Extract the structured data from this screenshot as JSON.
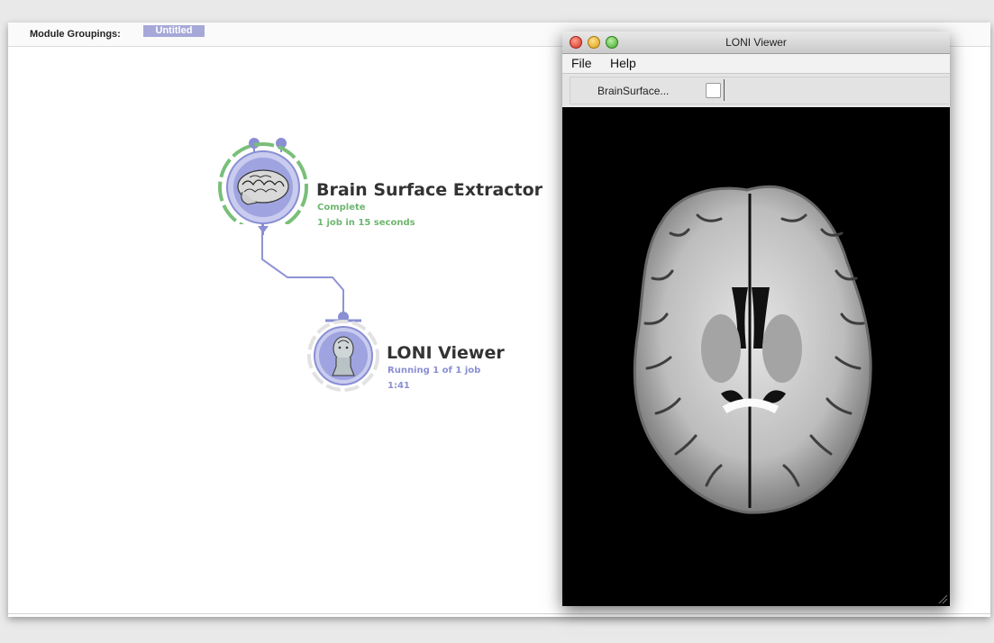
{
  "module_groupings": {
    "label": "Module Groupings:",
    "tab": "Untitled"
  },
  "nodes": [
    {
      "title": "Brain Surface Extractor",
      "status": "Complete",
      "detail": "1 job in 15 seconds",
      "state_color": "#6fb56f",
      "icon": "brain-surface-icon"
    },
    {
      "title": "LONI Viewer",
      "status": "Running 1 of 1 job",
      "detail": "1:41",
      "state_color": "#8a8fd3",
      "icon": "head-model-icon"
    }
  ],
  "viewer": {
    "title": "LONI Viewer",
    "menu": [
      "File",
      "Help"
    ],
    "toolbar_label": "BrainSurface...",
    "image": "axial-brain-mri-slice"
  },
  "colors": {
    "node_blue": "#8a8fd3",
    "complete_green": "#6fb56f",
    "tab_purple": "#a6a8d8"
  }
}
